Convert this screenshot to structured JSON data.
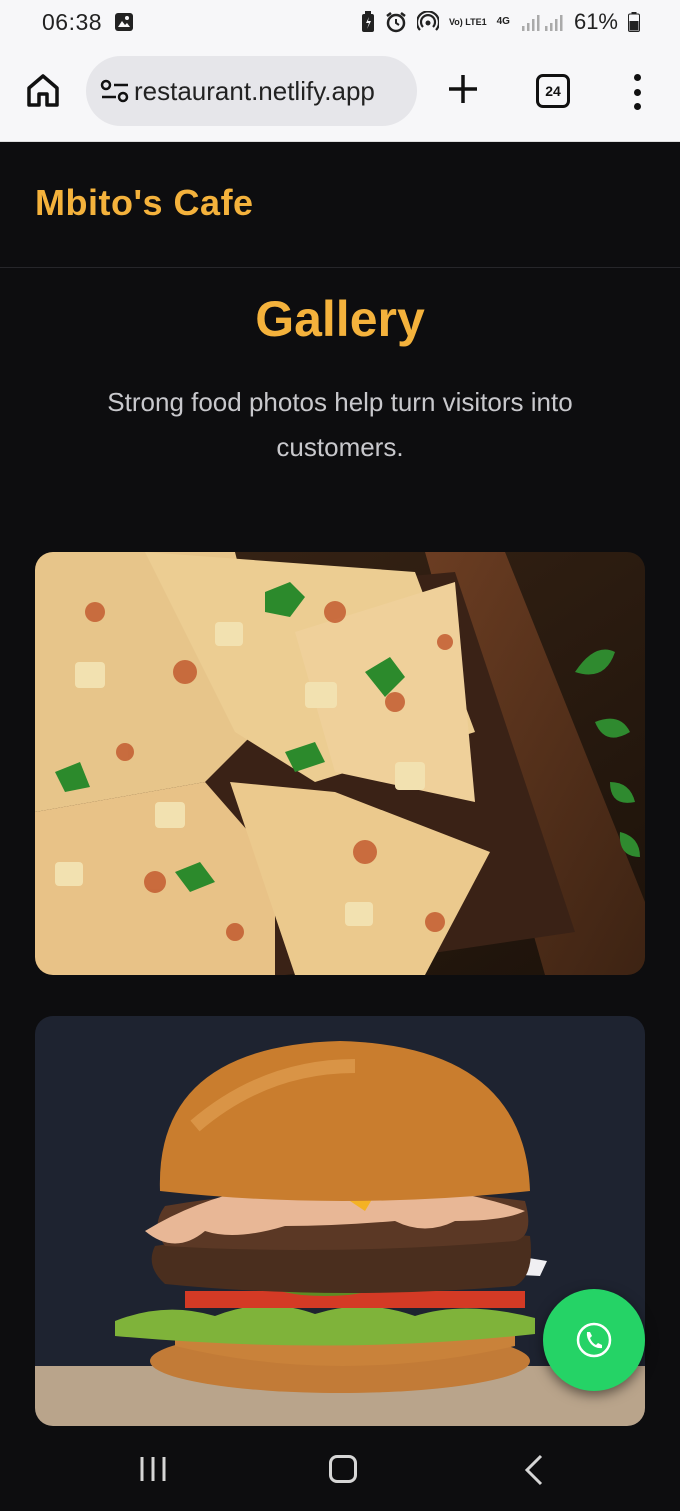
{
  "status_bar": {
    "time": "06:38",
    "battery": "61%",
    "network": "4G",
    "lte_label": "Vo) LTE1",
    "icons": [
      "gallery-icon",
      "battery-saver-icon",
      "alarm-icon",
      "hotspot-icon",
      "signal-icon",
      "battery-icon"
    ]
  },
  "browser": {
    "url": "restaurant.netlify.app",
    "tab_count": "24",
    "icons": [
      "home-icon",
      "site-settings-icon",
      "plus-icon",
      "tabs-icon",
      "more-vert-icon"
    ]
  },
  "site": {
    "brand": "Mbito's Cafe",
    "accent_color": "#f4b23c",
    "background_color": "#0d0d0f"
  },
  "gallery": {
    "title": "Gallery",
    "subtitle": "Strong food photos help turn visitors into customers.",
    "photos": [
      "pizza",
      "burger"
    ]
  },
  "floating_action": {
    "icon": "phone-icon",
    "color": "#25d366"
  },
  "system_nav": {
    "icons": [
      "recent-apps-icon",
      "home-nav-icon",
      "back-icon"
    ]
  }
}
